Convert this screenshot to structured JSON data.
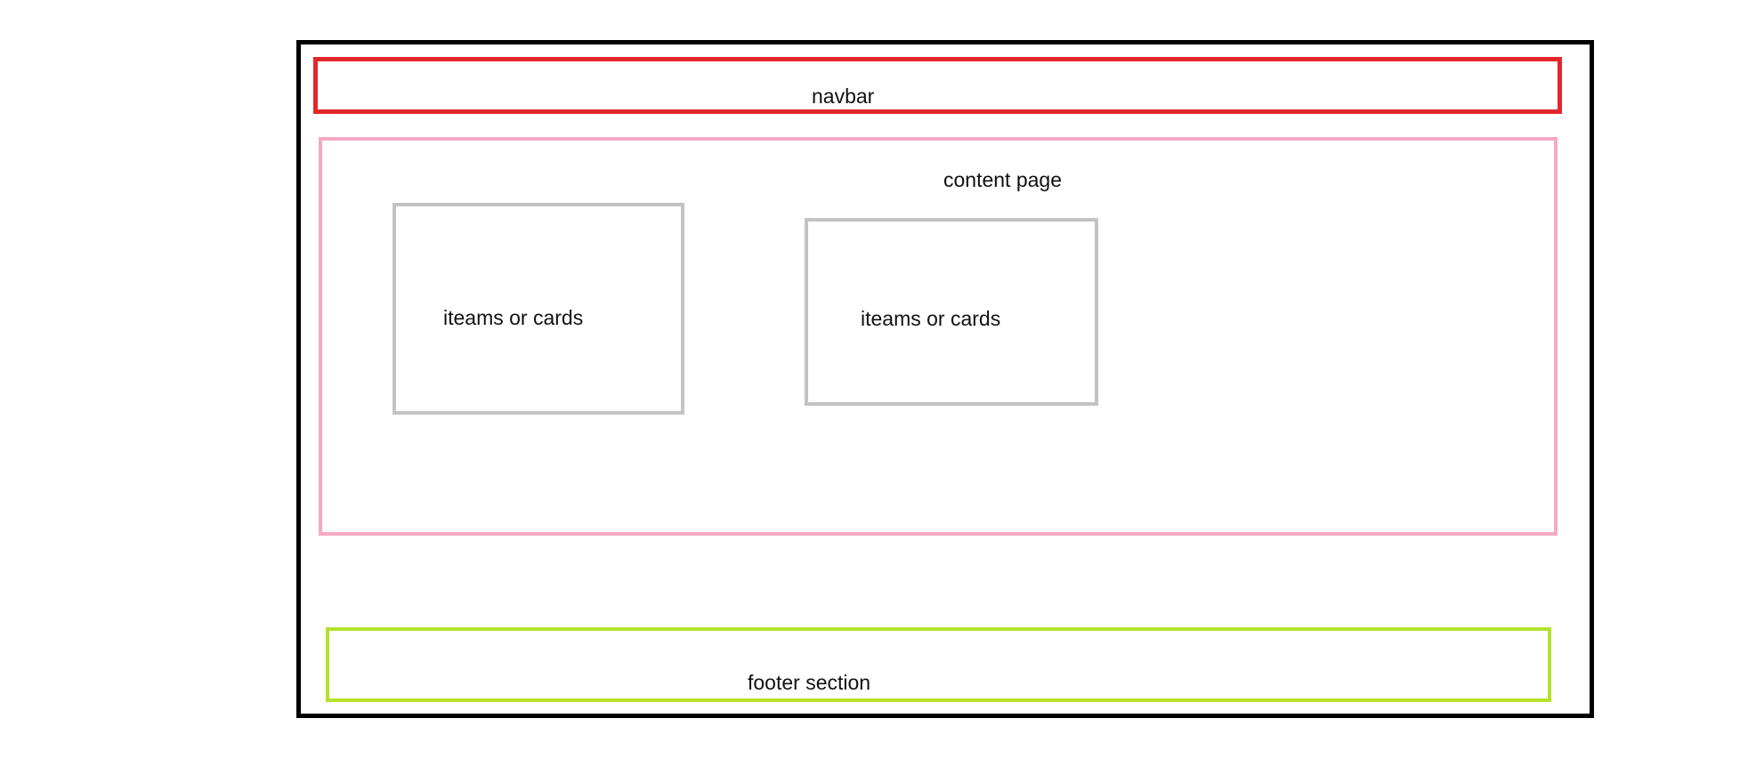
{
  "navbar": {
    "label": "navbar",
    "color": "#e3262c"
  },
  "content": {
    "label": "content page",
    "color": "#f4aac4"
  },
  "cards": [
    {
      "label": "iteams or cards",
      "color": "#c3c3c3"
    },
    {
      "label": "iteams or cards",
      "color": "#c3c3c3"
    }
  ],
  "footer": {
    "label": "footer section",
    "color": "#b5e12c"
  },
  "frame": {
    "color": "#000000"
  }
}
